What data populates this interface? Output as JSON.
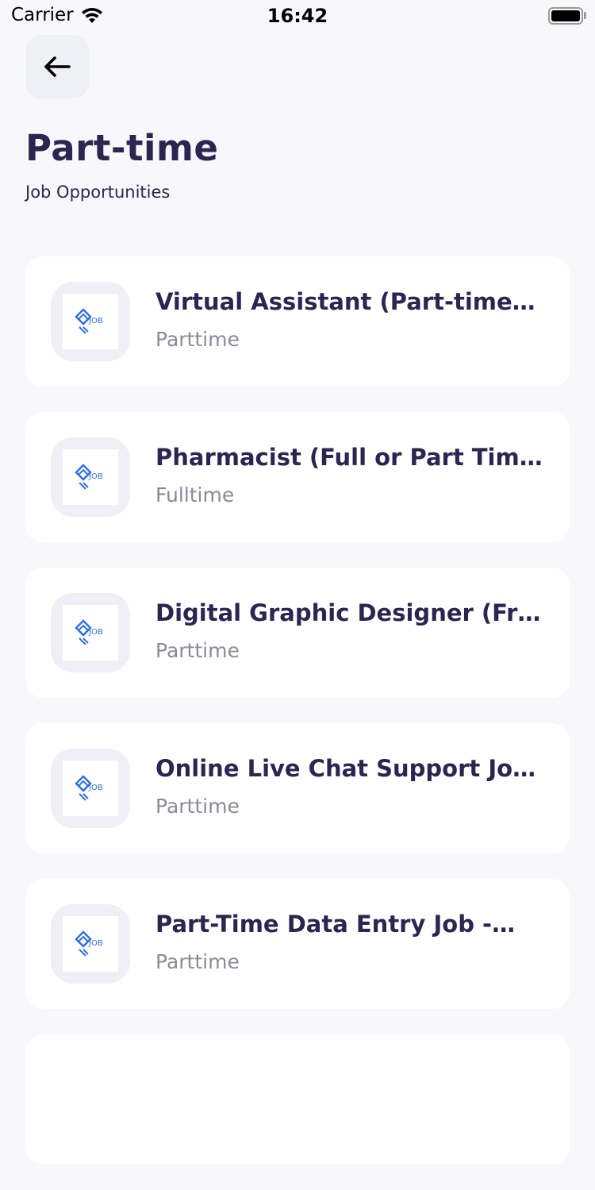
{
  "status_bar": {
    "carrier": "Carrier",
    "time": "16:42"
  },
  "header": {
    "title": "Part-time",
    "subtitle": "Job Opportunities"
  },
  "jobs": [
    {
      "title": "Virtual Assistant (Part-time…",
      "type": "Parttime",
      "logo_icon": "job-logo-icon"
    },
    {
      "title": "Pharmacist (Full or Part Time)",
      "type": "Fulltime",
      "logo_icon": "job-logo-icon"
    },
    {
      "title": "Digital Graphic Designer (Fr…",
      "type": "Parttime",
      "logo_icon": "job-logo-icon"
    },
    {
      "title": "Online Live Chat Support Jo…",
      "type": "Parttime",
      "logo_icon": "job-logo-icon"
    },
    {
      "title": "Part-Time Data Entry Job -…",
      "type": "Parttime",
      "logo_icon": "job-logo-icon"
    }
  ],
  "colors": {
    "background": "#f8f8fb",
    "title_text": "#2d2550",
    "secondary_text": "#8a8a9a",
    "logo_blue": "#2f6fe0"
  }
}
